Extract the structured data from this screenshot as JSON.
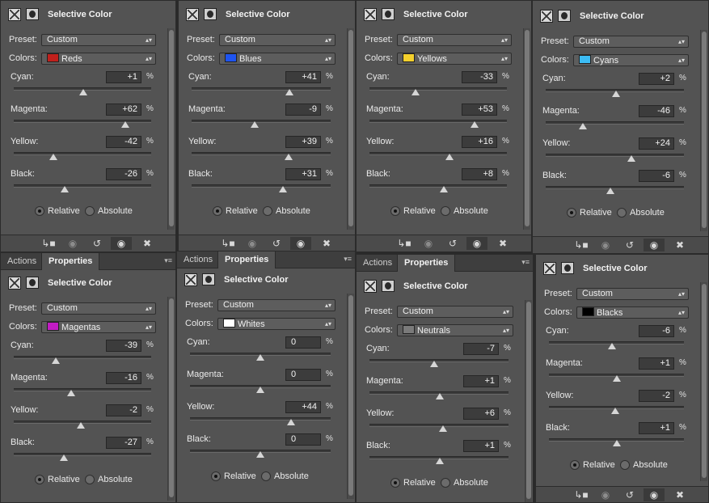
{
  "common": {
    "title": "Selective Color",
    "preset_label": "Preset:",
    "colors_label": "Colors:",
    "preset_value": "Custom",
    "cyan_label": "Cyan:",
    "magenta_label": "Magenta:",
    "yellow_label": "Yellow:",
    "black_label": "Black:",
    "pct": "%",
    "relative_label": "Relative",
    "absolute_label": "Absolute",
    "tab_actions": "Actions",
    "tab_properties": "Properties",
    "icons": {
      "adjustment": "selective-color-icon",
      "mask": "mask-icon",
      "clip": "clip-to-layer-icon",
      "view_previous": "view-previous-icon",
      "reset": "reset-icon",
      "visibility": "eye-icon",
      "delete": "trash-icon",
      "menu": "panel-menu-icon"
    }
  },
  "panels": [
    {
      "color_name": "Reds",
      "swatch": "#c0201c",
      "cyan": "+1",
      "magenta": "+62",
      "yellow": "-42",
      "black": "-26",
      "levels": {
        "cyan": 1,
        "magenta": 62,
        "yellow": -42,
        "black": -26
      }
    },
    {
      "color_name": "Blues",
      "swatch": "#1e54f0",
      "cyan": "+41",
      "magenta": "-9",
      "yellow": "+39",
      "black": "+31",
      "levels": {
        "cyan": 41,
        "magenta": -9,
        "yellow": 39,
        "black": 31
      }
    },
    {
      "color_name": "Yellows",
      "swatch": "#f4d02c",
      "cyan": "-33",
      "magenta": "+53",
      "yellow": "+16",
      "black": "+8",
      "levels": {
        "cyan": -33,
        "magenta": 53,
        "yellow": 16,
        "black": 8
      }
    },
    {
      "color_name": "Cyans",
      "swatch": "#3cbcf4",
      "cyan": "+2",
      "magenta": "-46",
      "yellow": "+24",
      "black": "-6",
      "levels": {
        "cyan": 2,
        "magenta": -46,
        "yellow": 24,
        "black": -6
      }
    },
    {
      "color_name": "Magentas",
      "swatch": "#c21cc4",
      "cyan": "-39",
      "magenta": "-16",
      "yellow": "-2",
      "black": "-27",
      "levels": {
        "cyan": -39,
        "magenta": -16,
        "yellow": -2,
        "black": -27
      }
    },
    {
      "color_name": "Whites",
      "swatch": "#ffffff",
      "cyan": "0",
      "magenta": "0",
      "yellow": "+44",
      "black": "0",
      "levels": {
        "cyan": 0,
        "magenta": 0,
        "yellow": 44,
        "black": 0
      }
    },
    {
      "color_name": "Neutrals",
      "swatch": "#7a7a7a",
      "cyan": "-7",
      "magenta": "+1",
      "yellow": "+6",
      "black": "+1",
      "levels": {
        "cyan": -7,
        "magenta": 1,
        "yellow": 6,
        "black": 1
      }
    },
    {
      "color_name": "Blacks",
      "swatch": "#000000",
      "cyan": "-6",
      "magenta": "+1",
      "yellow": "-2",
      "black": "+1",
      "levels": {
        "cyan": -6,
        "magenta": 1,
        "yellow": -2,
        "black": 1
      }
    }
  ],
  "range": [
    -100,
    100
  ],
  "selected_mode": "Relative"
}
